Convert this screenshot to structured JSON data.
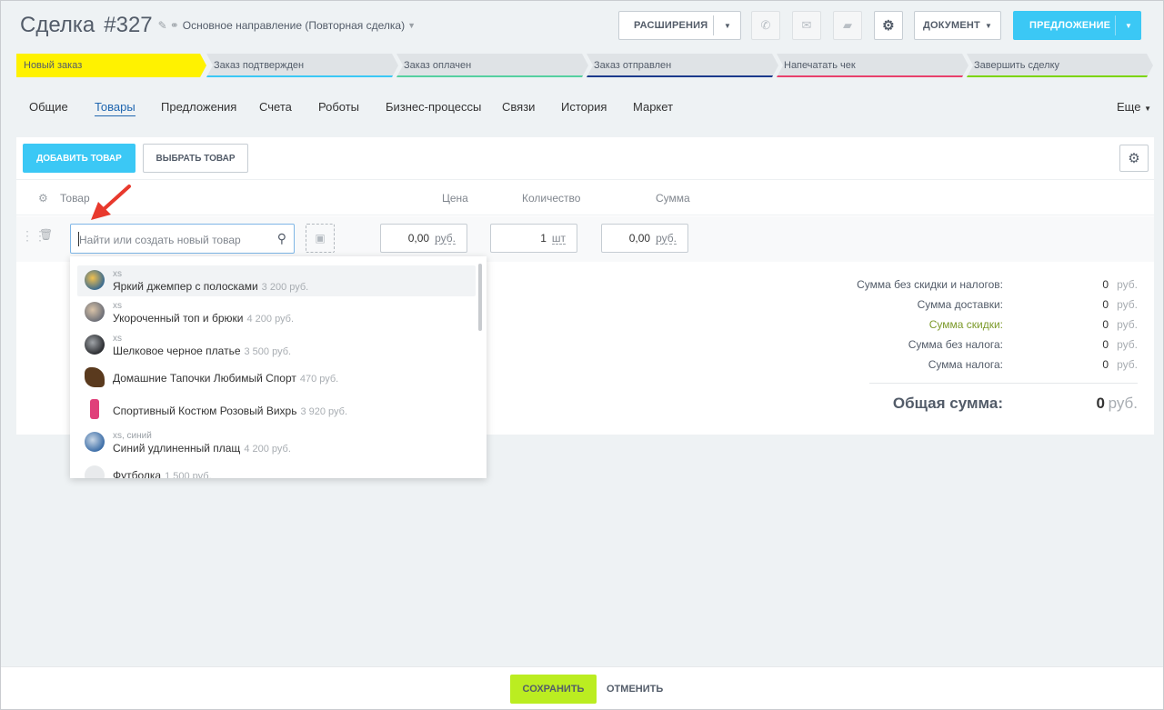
{
  "header": {
    "title": "Сделка",
    "number": "#327",
    "direction": "Основное направление (Повторная сделка)"
  },
  "actions": {
    "extensions": "РАСШИРЕНИЯ",
    "document": "ДОКУМЕНТ",
    "proposal": "ПРЕДЛОЖЕНИЕ"
  },
  "stages": [
    {
      "label": "Новый заказ",
      "color": "#fff200"
    },
    {
      "label": "Заказ подтвержден",
      "color": "#3bc8f5"
    },
    {
      "label": "Заказ оплачен",
      "color": "#55d0a0"
    },
    {
      "label": "Заказ отправлен",
      "color": "#1b3a8c"
    },
    {
      "label": "Напечатать чек",
      "color": "#e8416c"
    },
    {
      "label": "Завершить сделку",
      "color": "#7bd500"
    }
  ],
  "tabs": [
    "Общие",
    "Товары",
    "Предложения",
    "Счета",
    "Роботы",
    "Бизнес-процессы",
    "Связи",
    "История",
    "Маркет"
  ],
  "tabs_more": "Еще",
  "products": {
    "add_button": "ДОБАВИТЬ ТОВАР",
    "choose_button": "ВЫБРАТЬ ТОВАР",
    "columns": {
      "product": "Товар",
      "price": "Цена",
      "quantity": "Количество",
      "sum": "Сумма"
    },
    "row": {
      "search_placeholder": "Найти или создать новый товар",
      "price": "0,00",
      "price_unit": "руб.",
      "quantity": "1",
      "quantity_unit": "шт",
      "sum": "0,00",
      "sum_unit": "руб."
    }
  },
  "dropdown": [
    {
      "meta": "xs",
      "name": "Яркий джемпер с полосками",
      "price": "3 200 руб."
    },
    {
      "meta": "xs",
      "name": "Укороченный топ и брюки",
      "price": "4 200 руб."
    },
    {
      "meta": "xs",
      "name": "Шелковое черное платье",
      "price": "3 500 руб."
    },
    {
      "meta": "",
      "name": "Домашние Тапочки Любимый Спорт",
      "price": "470 руб."
    },
    {
      "meta": "",
      "name": "Спортивный Костюм Розовый Вихрь",
      "price": "3 920 руб."
    },
    {
      "meta": "xs, синий",
      "name": "Синий удлиненный плащ",
      "price": "4 200 руб."
    },
    {
      "meta": "",
      "name": "Футболка",
      "price": "1 500 руб."
    }
  ],
  "totals": {
    "rows": [
      {
        "label": "Сумма без скидки и налогов:",
        "value": "0",
        "unit": "руб."
      },
      {
        "label": "Сумма доставки:",
        "value": "0",
        "unit": "руб."
      },
      {
        "label": "Сумма скидки:",
        "value": "0",
        "unit": "руб."
      },
      {
        "label": "Сумма без налога:",
        "value": "0",
        "unit": "руб."
      },
      {
        "label": "Сумма налога:",
        "value": "0",
        "unit": "руб."
      }
    ],
    "discount_color": "#7c9a2a",
    "grand_label": "Общая сумма:",
    "grand_value": "0",
    "grand_unit": "руб."
  },
  "footer": {
    "save": "СОХРАНИТЬ",
    "cancel": "ОТМЕНИТЬ"
  },
  "colors": {
    "accent_blue": "#3bc8f5",
    "save_green": "#bbed21",
    "active_tab": "#2067b0"
  }
}
